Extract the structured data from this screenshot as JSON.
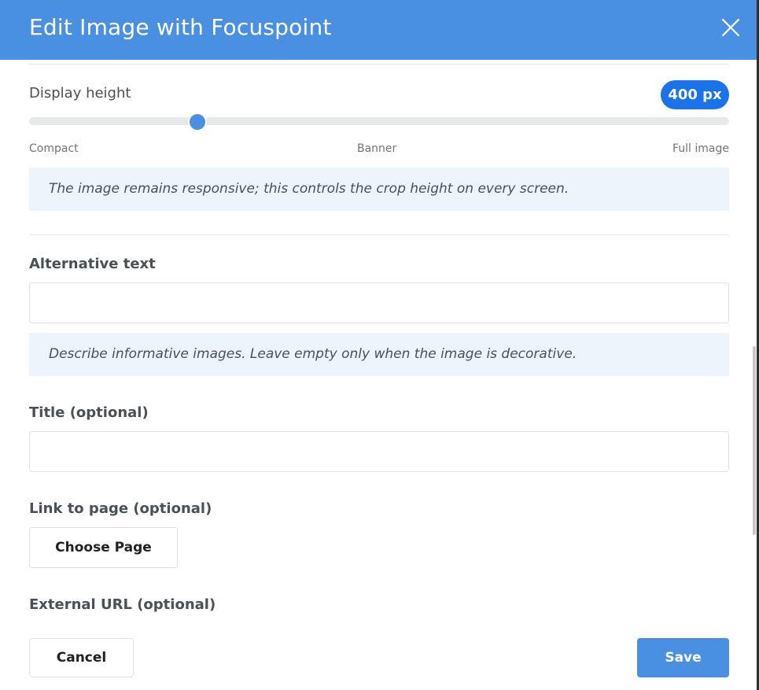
{
  "dialog": {
    "title": "Edit Image with Focuspoint",
    "close_icon": "close-icon"
  },
  "display_height": {
    "label": "Display height",
    "value_badge": "400 px",
    "slider_position_fraction": 0.24,
    "scale_labels": {
      "min": "Compact",
      "mid": "Banner",
      "max": "Full image"
    },
    "hint": "The image remains responsive; this controls the crop height on every screen."
  },
  "alt_text": {
    "label": "Alternative text",
    "value": "",
    "placeholder": "",
    "hint": "Describe informative images. Leave empty only when the image is decorative."
  },
  "title_field": {
    "label": "Title (optional)",
    "value": "",
    "placeholder": ""
  },
  "link_page": {
    "label": "Link to page (optional)",
    "button_label": "Choose Page"
  },
  "external_url": {
    "label": "External URL (optional)"
  },
  "footer": {
    "cancel_label": "Cancel",
    "save_label": "Save"
  },
  "colors": {
    "header": "#4a90e2",
    "badge": "#1a73e8",
    "primary_button": "#4a90e2",
    "hint_background": "#edf4fb"
  }
}
